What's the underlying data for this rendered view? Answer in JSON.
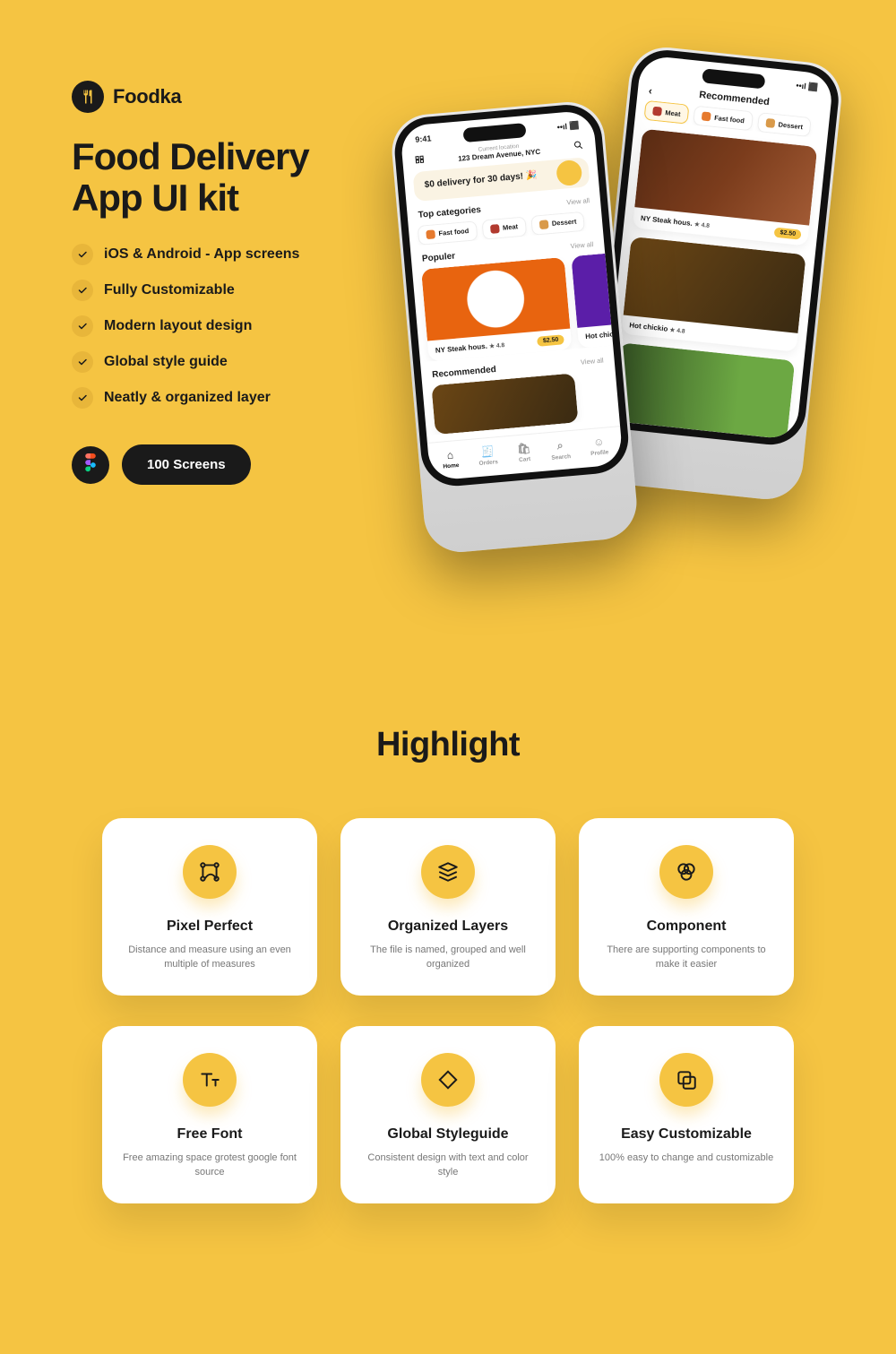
{
  "brand": {
    "name": "Foodka"
  },
  "hero": {
    "title": "Food Delivery App UI kit",
    "features": [
      "iOS & Android - App screens",
      "Fully Customizable",
      "Modern layout design",
      "Global style guide",
      "Neatly & organized layer"
    ],
    "cta": "100 Screens"
  },
  "phoneA": {
    "time": "9:41",
    "location_label": "Current location",
    "location_value": "123 Dream Avenue, NYC",
    "promo": "$0 delivery for 30 days! 🎉",
    "sec1_title": "Top categories",
    "sec1_link": "View all",
    "categories": [
      {
        "label": "Fast food",
        "color": "#e67a2e"
      },
      {
        "label": "Meat",
        "color": "#b23a2f"
      },
      {
        "label": "Dessert",
        "color": "#d99a4a"
      }
    ],
    "sec2_title": "Populer",
    "sec2_link": "View all",
    "popular": [
      {
        "name": "NY Steak hous.",
        "rating": "4.8",
        "price": "$2.50"
      },
      {
        "name": "Hot chick",
        "rating": "",
        "price": ""
      }
    ],
    "sec3_title": "Recommended",
    "sec3_link": "View all",
    "tabs": [
      "Home",
      "Orders",
      "Cart",
      "Search",
      "Profile"
    ]
  },
  "phoneB": {
    "header": "Recommended",
    "chips": [
      {
        "label": "Meat",
        "active": true,
        "color": "#b23a2f"
      },
      {
        "label": "Fast food",
        "active": false,
        "color": "#e67a2e"
      },
      {
        "label": "Dessert",
        "active": false,
        "color": "#d99a4a"
      }
    ],
    "items": [
      {
        "name": "NY Steak hous.",
        "rating": "4.8",
        "price": "$2.50"
      },
      {
        "name": "Hot chickio",
        "rating": "4.8",
        "price": ""
      }
    ]
  },
  "highlight": {
    "title": "Highlight",
    "cards": [
      {
        "title": "Pixel Perfect",
        "desc": "Distance and measure using an even multiple of measures"
      },
      {
        "title": "Organized Layers",
        "desc": "The file is named, grouped and well organized"
      },
      {
        "title": "Component",
        "desc": "There are supporting components to make it easier"
      },
      {
        "title": "Free Font",
        "desc": "Free amazing space grotest google font source"
      },
      {
        "title": "Global Styleguide",
        "desc": "Consistent design with text and color style"
      },
      {
        "title": "Easy Customizable",
        "desc": "100% easy to change and customizable"
      }
    ]
  }
}
